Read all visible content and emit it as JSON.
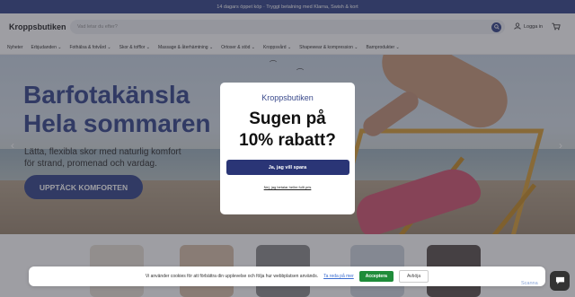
{
  "topbar": {
    "text": "14 dagars öppet köp · Tryggt betalning med Klarna, Swish & kort"
  },
  "header": {
    "logo": "Kroppsbutiken",
    "search_placeholder": "Vad letar du efter?",
    "login": "Logga in"
  },
  "nav": {
    "items": [
      "Nyheter",
      "Erbjudanden ⌄",
      "Fothälsa & fotvård ⌄",
      "Skor & tofflor ⌄",
      "Massage & återhämtning ⌄",
      "Ortoser & stöd ⌄",
      "Kroppsvård ⌄",
      "Shapewear & kompression ⌄",
      "Barnprodukter ⌄"
    ]
  },
  "hero": {
    "title_line1": "Barfotakänsla",
    "title_line2": "Hela sommaren",
    "subtitle_line1": "Lätta, flexibla skor med naturlig komfort",
    "subtitle_line2": "för strand, promenad och vardag.",
    "cta": "UPPTÄCK KOMFORTEN"
  },
  "modal": {
    "logo": "Kroppsbutiken",
    "title_line1": "Sugen på",
    "title_line2": "10% rabatt?",
    "accept": "Ja, jag vill spara",
    "decline": "Nej, jag betalar hellre fullt pris"
  },
  "cookie": {
    "text": "Vi använder cookies för att förbättra din upplevelse och följa hur webbplatsen används.",
    "link": "Ta reda på mer",
    "accept": "Acceptera",
    "reject": "Avböja"
  },
  "widget": {
    "label": "Scanna"
  },
  "colors": {
    "brand": "#3a4a8c",
    "accept": "#1f8c3a"
  },
  "icons": {
    "search": "search-icon",
    "user": "user-icon",
    "cart": "cart-icon",
    "chat": "chat-icon"
  }
}
